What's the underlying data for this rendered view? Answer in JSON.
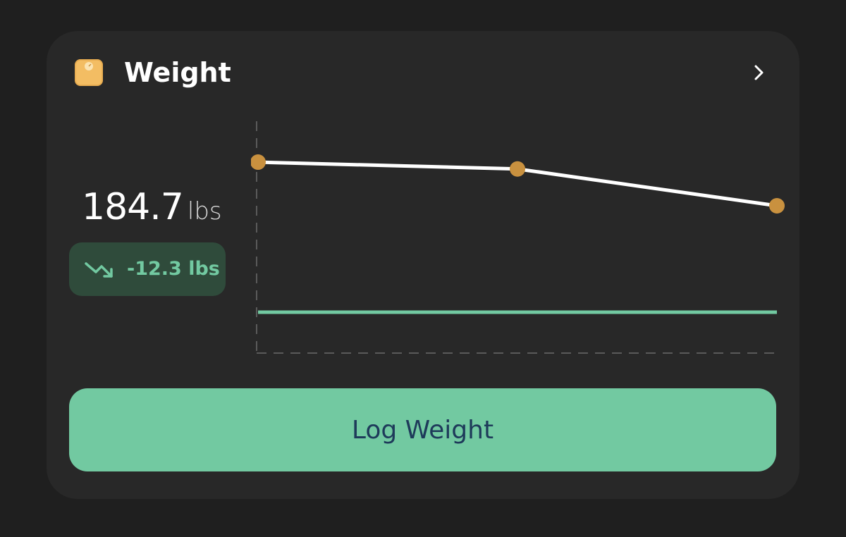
{
  "card": {
    "title": "Weight",
    "icon": "scale-icon",
    "nav_icon": "chevron-right-icon"
  },
  "current": {
    "value": "184.7",
    "unit": "lbs"
  },
  "change": {
    "text": "-12.3 lbs",
    "icon": "trending-down-icon"
  },
  "colors": {
    "background": "#1f1f1f",
    "card": "#282828",
    "accent_green": "#72c9a1",
    "badge_bg": "#2f4b3b",
    "point": "#c9913f",
    "icon_bg": "#f3bd63",
    "button_text": "#1e3a5a"
  },
  "chart_data": {
    "type": "line",
    "series": [
      {
        "values": [
          191.0,
          190.5,
          187.8
        ]
      }
    ],
    "goal_value": 180,
    "ylim": [
      177,
      194
    ],
    "axes_style": "dashed",
    "grid": false
  },
  "button": {
    "label": "Log Weight"
  }
}
